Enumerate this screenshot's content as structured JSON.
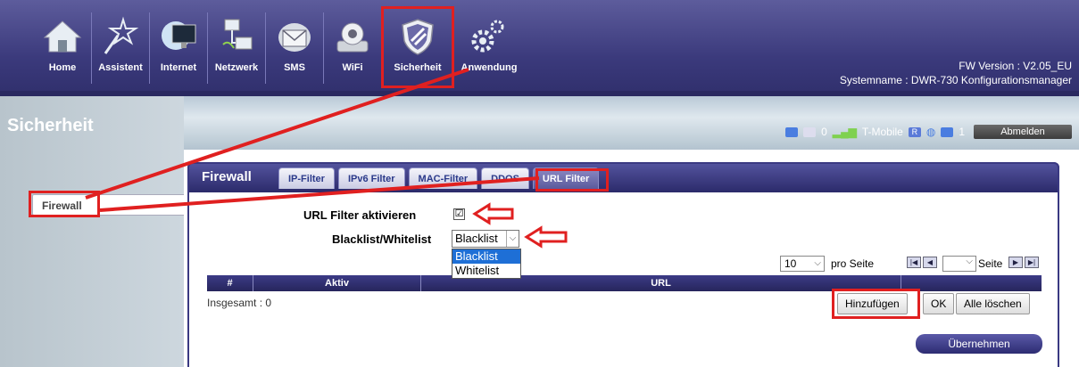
{
  "nav": {
    "items": [
      {
        "label": "Home",
        "icon": "home-icon"
      },
      {
        "label": "Assistent",
        "icon": "wand-icon"
      },
      {
        "label": "Internet",
        "icon": "globe-monitor-icon"
      },
      {
        "label": "Netzwerk",
        "icon": "network-icon"
      },
      {
        "label": "SMS",
        "icon": "envelope-icon"
      },
      {
        "label": "WiFi",
        "icon": "wifi-icon"
      },
      {
        "label": "Sicherheit",
        "icon": "shield-icon"
      },
      {
        "label": "Anwendung",
        "icon": "gears-icon"
      }
    ],
    "active": "Sicherheit"
  },
  "fw_info": {
    "version": "FW Version : V2.05_EU",
    "system_name": "Systemname : DWR-730 Konfigurationsmanager"
  },
  "page_title": "Sicherheit",
  "status": {
    "sms_count": "0",
    "carrier": "T-Mobile",
    "roaming": "R",
    "clients": "1",
    "logout_label": "Abmelden"
  },
  "sidebar": {
    "items": [
      {
        "label": "Firewall"
      }
    ]
  },
  "panel": {
    "title": "Firewall",
    "tabs": [
      {
        "label": "IP-Filter"
      },
      {
        "label": "IPv6 Filter"
      },
      {
        "label": "MAC-Filter"
      },
      {
        "label": "DDOS"
      },
      {
        "label": "URL Filter",
        "active": true
      }
    ]
  },
  "form": {
    "enable_label": "URL Filter aktivieren",
    "enable_checked": "☑",
    "list_label": "Blacklist/Whitelist",
    "list_value": "Blacklist",
    "list_options": [
      "Blacklist",
      "Whitelist"
    ]
  },
  "pager": {
    "per_page_value": "10",
    "per_page_label": "pro Seite",
    "page_label": "Seite"
  },
  "table": {
    "columns": [
      "#",
      "Aktiv",
      "URL"
    ],
    "total_label": "Insgesamt : 0"
  },
  "buttons": {
    "add": "Hinzufügen",
    "ok": "OK",
    "delete_all": "Alle löschen",
    "apply": "Übernehmen"
  },
  "colors": {
    "accent": "#3b3a7c",
    "highlight": "#e02020",
    "selected": "#1e6fd6"
  }
}
